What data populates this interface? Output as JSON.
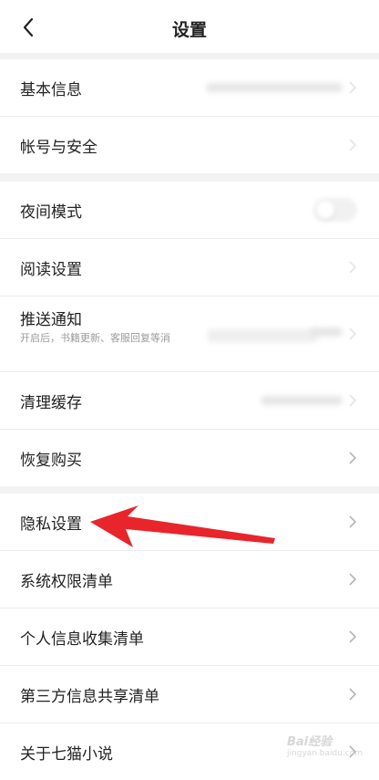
{
  "header": {
    "title": "设置"
  },
  "groups": [
    {
      "items": [
        {
          "label": "基本信息"
        },
        {
          "label": "帐号与安全"
        }
      ]
    },
    {
      "items": [
        {
          "label": "夜间模式"
        },
        {
          "label": "阅读设置"
        },
        {
          "label": "推送通知",
          "subtitle": "开启后，书籍更新、客服回复等消"
        },
        {
          "label": "清理缓存"
        },
        {
          "label": "恢复购买"
        }
      ]
    },
    {
      "items": [
        {
          "label": "隐私设置"
        },
        {
          "label": "系统权限清单"
        },
        {
          "label": "个人信息收集清单"
        },
        {
          "label": "第三方信息共享清单"
        },
        {
          "label": "关于七猫小说"
        }
      ]
    }
  ],
  "annotation": {
    "arrow_color": "#e8252b"
  },
  "watermark": {
    "text": "Bai经验",
    "url": "jingyan.baidu.com"
  }
}
